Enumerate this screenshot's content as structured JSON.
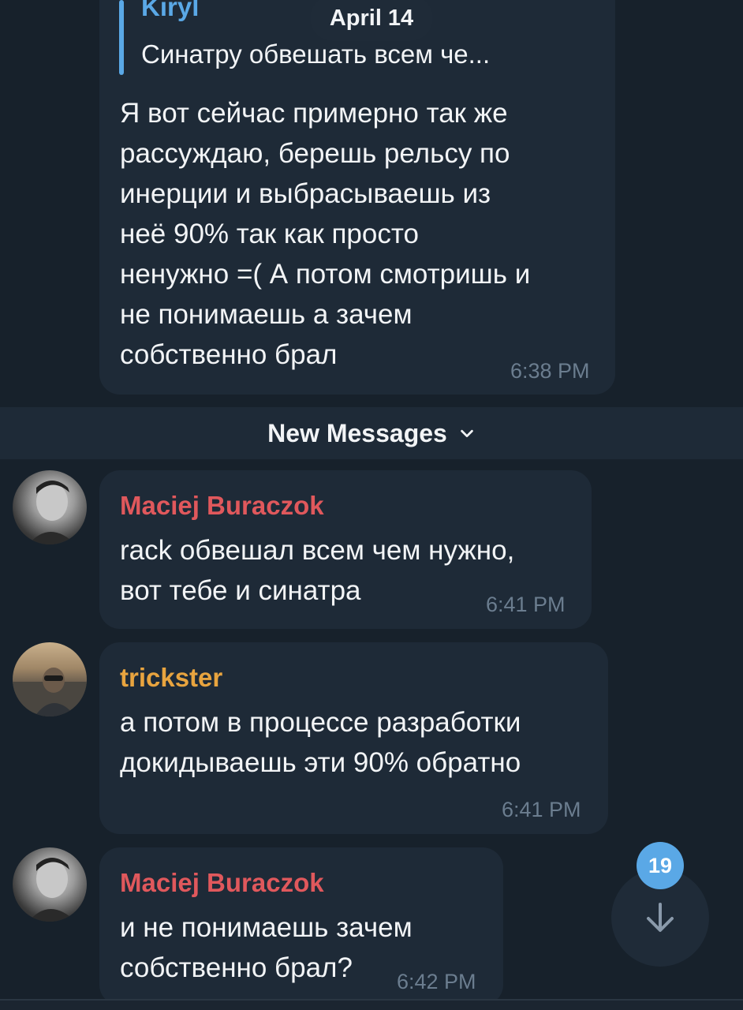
{
  "date_pill": "April 14",
  "messages": [
    {
      "reply": {
        "author": "Kiryl",
        "text": "Синатру обвешать всем че..."
      },
      "text": "Я вот сейчас примерно так же\nрассуждаю, берешь рельсу по\nинерции и выбрасываешь из\nнеё 90% так как просто\nненужно =( А потом смотришь и\nне понимаешь а зачем\nсобственно брал",
      "time": "6:38 PM"
    },
    {
      "sender": "Maciej Buraczok",
      "text": "rack обвешал всем чем нужно,\nвот тебе и синатра",
      "time": "6:41 PM"
    },
    {
      "sender": "trickster",
      "text": "а потом в процессе разработки\nдокидываешь эти 90% обратно",
      "time": "6:41 PM"
    },
    {
      "sender": "Maciej Buraczok",
      "text": "и не понимаешь зачем\nсобственно брал?",
      "time": "6:42 PM"
    }
  ],
  "new_messages_label": "New Messages",
  "unread_count": "19",
  "colors": {
    "background": "#17212b",
    "bubble": "#1e2a37",
    "accent": "#5aa8e6",
    "sender_maciej": "#e0585c",
    "sender_trickster": "#e8a43f",
    "timestamp": "#6b7d8f"
  },
  "icons": {
    "chevron": "chevron-down-icon",
    "scroll_down": "arrow-down-icon"
  }
}
